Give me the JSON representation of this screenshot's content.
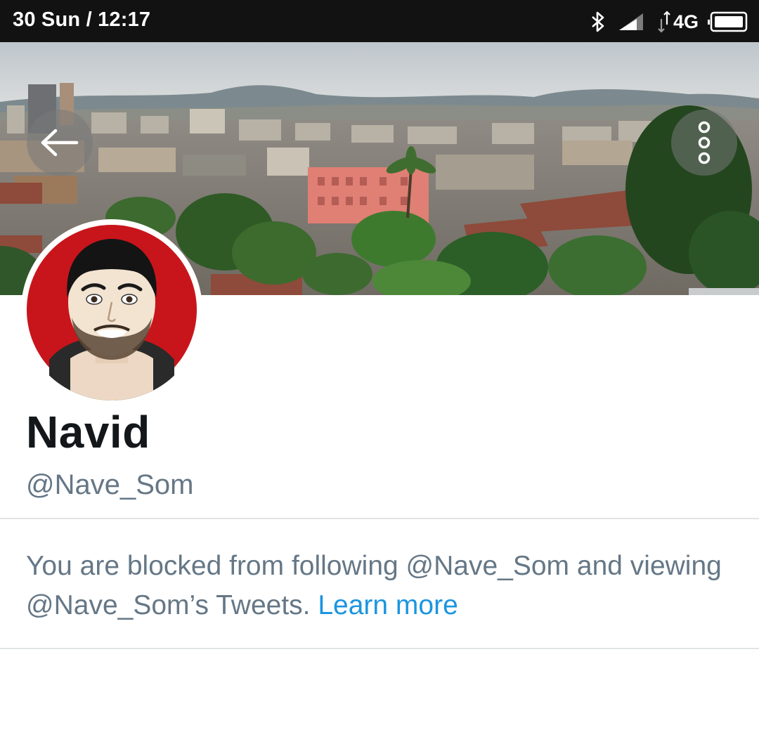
{
  "status_bar": {
    "date": "30 Sun",
    "separator": "/",
    "time": "12:17",
    "network_label": "4G",
    "icons": [
      "bluetooth-icon",
      "signal-icon",
      "data-arrows-icon",
      "battery-icon"
    ]
  },
  "header": {
    "back_icon": "arrow-left-icon",
    "more_icon": "more-vertical-icon"
  },
  "profile": {
    "display_name": "Navid",
    "handle": "@Nave_Som"
  },
  "notice": {
    "text": "You are blocked from following @Nave_Som and viewing @Nave_Som’s Tweets.",
    "link_label": "Learn more"
  },
  "colors": {
    "status_bar_bg": "#121212",
    "name_text": "#14171a",
    "secondary_text": "#657786",
    "link": "#1b95e0",
    "divider": "#e1e4e7",
    "avatar_bg": "#c8151b"
  }
}
